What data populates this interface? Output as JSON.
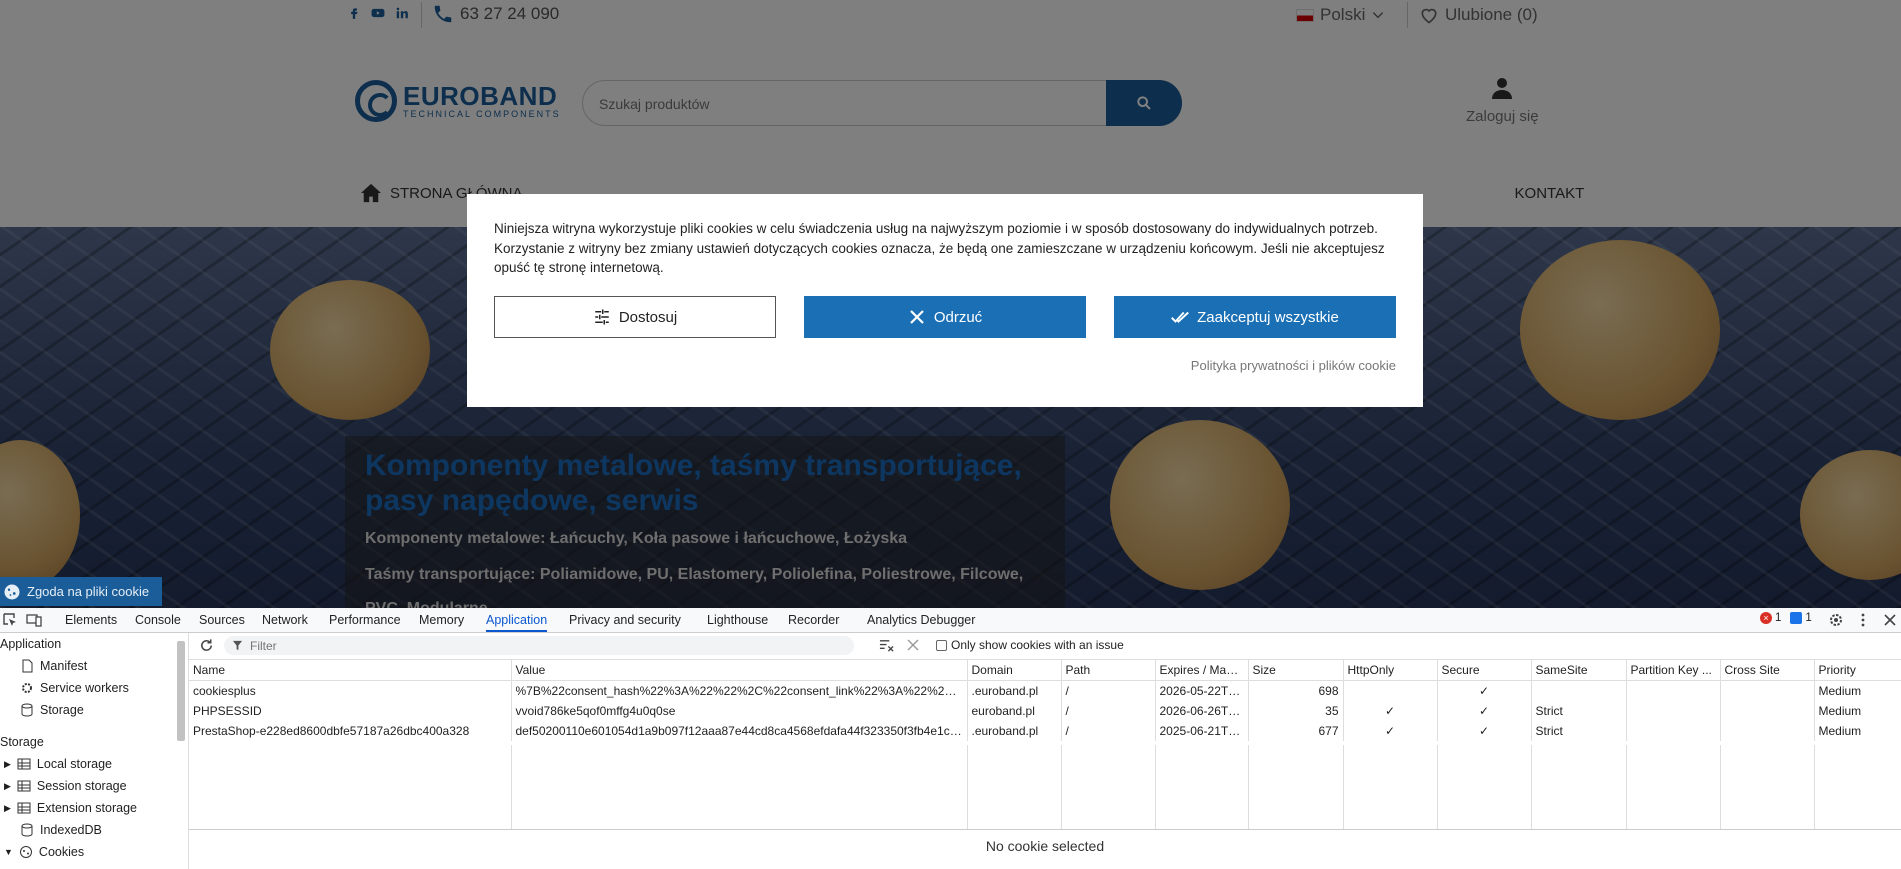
{
  "site": {
    "phone": "63 27 24 090",
    "language": "Polski",
    "wishlist": "Ulubione (0)",
    "logo_name": "EUROBAND",
    "logo_sub": "TECHNICAL COMPONENTS",
    "search_placeholder": "Szukaj produktów",
    "login": "Zaloguj się",
    "nav": [
      "STRONA GŁÓWNA",
      "KONTAKT"
    ],
    "hero": {
      "title": "Komponenty metalowe, taśmy transportujące, pasy napędowe, serwis",
      "line1": "Komponenty metalowe: Łańcuchy, Koła pasowe i łańcuchowe, Łożyska",
      "line2": "Taśmy transportujące: Poliamidowe, PU, Elastomery, Poliolefina, Poliestrowe, Filcowe,",
      "line3": "PVC, Modularne"
    },
    "consent_tab": "Zgoda na pliki cookie",
    "modal": {
      "text": "Niniejsza witryna wykorzystuje pliki cookies w celu świadczenia usług na najwyższym poziomie i w sposób dostosowany do indywidualnych potrzeb. Korzystanie z witryny bez zmiany ustawień dotyczących cookies oznacza, że będą one zamieszczane w urządzeniu końcowym. Jeśli nie akceptujesz opuść tę stronę internetową.",
      "customize": "Dostosuj",
      "reject": "Odrzuć",
      "accept": "Zaakceptuj wszystkie",
      "policy_link": "Polityka prywatności i plików cookie"
    },
    "colors": {
      "brand": "#1a5d98",
      "button": "#1a6fb5"
    }
  },
  "devtools": {
    "tabs": [
      "Elements",
      "Console",
      "Sources",
      "Network",
      "Performance",
      "Memory",
      "Application",
      "Privacy and security",
      "Lighthouse",
      "Recorder",
      "Analytics Debugger"
    ],
    "active_tab": "Application",
    "error_count": "1",
    "message_count": "1",
    "sidebar": {
      "application_header": "Application",
      "application_items": [
        "Manifest",
        "Service workers",
        "Storage"
      ],
      "storage_header": "Storage",
      "storage_items": [
        "Local storage",
        "Session storage",
        "Extension storage",
        "IndexedDB",
        "Cookies"
      ]
    },
    "filter_placeholder": "Filter",
    "only_issue_label": "Only show cookies with an issue",
    "columns": [
      "Name",
      "Value",
      "Domain",
      "Path",
      "Expires / Max-...",
      "Size",
      "HttpOnly",
      "Secure",
      "SameSite",
      "Partition Key ...",
      "Cross Site",
      "Priority"
    ],
    "rows": [
      [
        "cookiesplus",
        "%7B%22consent_hash%22%3A%22%22%2C%22consent_link%22%3A%22%2C...",
        ".euroband.pl",
        "/",
        "2026-05-22T0...",
        "698",
        "",
        "✓",
        "",
        "",
        "",
        "Medium"
      ],
      [
        "PHPSESSID",
        "vvoid786ke5qof0mffg4u0q0se",
        "euroband.pl",
        "/",
        "2026-06-26T0...",
        "35",
        "✓",
        "✓",
        "Strict",
        "",
        "",
        "Medium"
      ],
      [
        "PrestaShop-e228ed8600dbfe57187a26dbc400a328",
        "def50200110e601054d1a9b097f12aaa87e44cd8ca4568efdafa44f323350f3fb4e1c61...",
        ".euroband.pl",
        "/",
        "2025-06-21T0...",
        "677",
        "✓",
        "✓",
        "Strict",
        "",
        "",
        "Medium"
      ]
    ],
    "no_selection": "No cookie selected"
  }
}
